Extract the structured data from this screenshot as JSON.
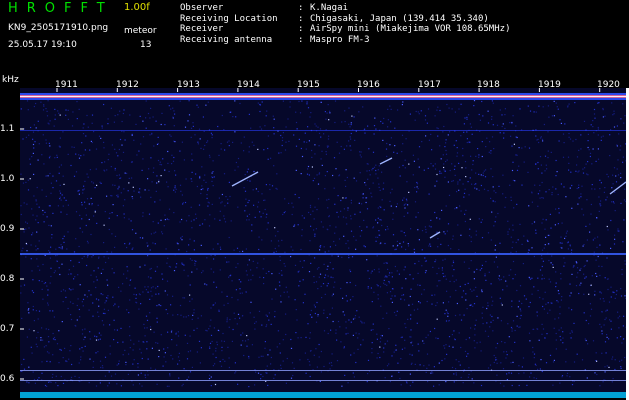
{
  "header": {
    "app_title": "HROFFT",
    "version": "1.00f",
    "file_name": "KN9_2505171910.png",
    "counter_label": "meteor",
    "datetime": "25.05.17 19:10",
    "counter_value": "13"
  },
  "info": [
    {
      "key": "Observer",
      "sep": ":",
      "value": "K.Nagai"
    },
    {
      "key": "Receiving Location",
      "sep": ":",
      "value": "Chigasaki, Japan (139.414 35.340)"
    },
    {
      "key": "Receiver",
      "sep": ":",
      "value": "AirSpy mini (Miakejima VOR 108.65MHz)"
    },
    {
      "key": "Receiving antenna",
      "sep": ":",
      "value": "Maspro FM-3"
    }
  ],
  "axis": {
    "unit": "kHz",
    "y_ticks": [
      "1.1",
      "1.0",
      "0.9",
      "0.8",
      "0.7",
      "0.6"
    ],
    "x_ticks": [
      "1911",
      "1912",
      "1913",
      "1914",
      "1915",
      "1916",
      "1917",
      "1918",
      "1919",
      "1920"
    ]
  },
  "colors": {
    "background": "#000000",
    "plot_bg": "#06082a",
    "title_green": "#00e000",
    "version_yellow": "#e0e000",
    "noise_blue": "#2a3cff",
    "baseline_cyan": "#00ffff"
  }
}
